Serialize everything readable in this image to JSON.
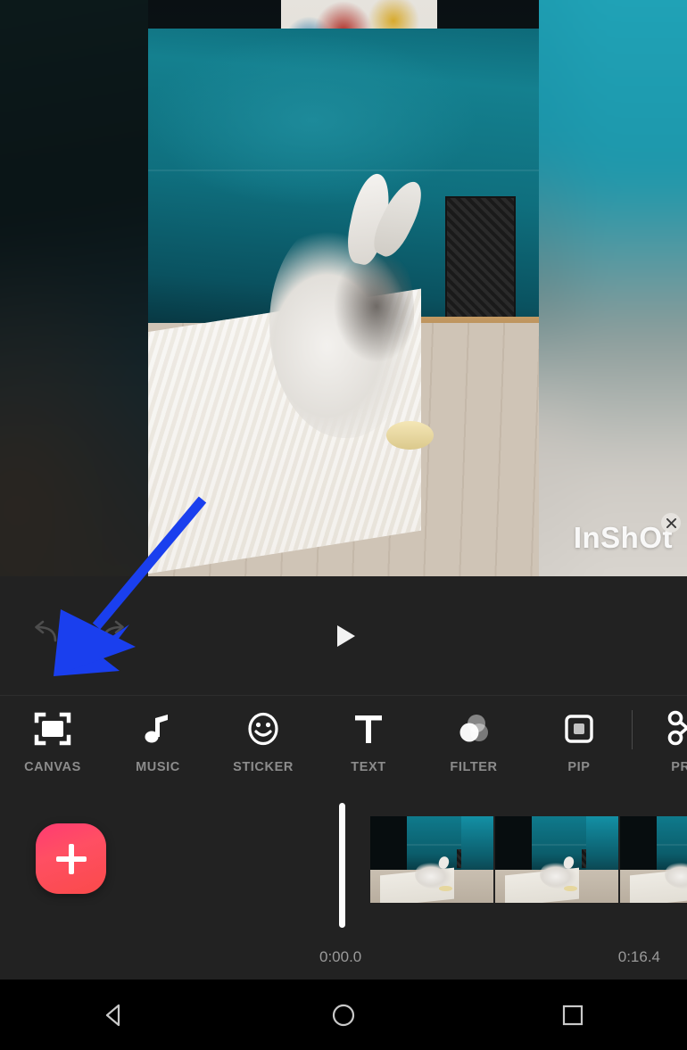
{
  "app": {
    "name": "InShot",
    "watermark": "InShOt"
  },
  "preview": {
    "watermark_close_icon": "close-icon",
    "media_description": "Fluffy white and grey rabbit on a light rug in front of a teal velvet sofa"
  },
  "transport": {
    "undo_icon": "undo-icon",
    "redo_icon": "redo-icon",
    "play_icon": "play-icon"
  },
  "toolbar": {
    "items": [
      {
        "label": "CANVAS",
        "icon": "canvas-icon"
      },
      {
        "label": "MUSIC",
        "icon": "music-note-icon"
      },
      {
        "label": "STICKER",
        "icon": "smiley-icon"
      },
      {
        "label": "TEXT",
        "icon": "text-t-icon"
      },
      {
        "label": "FILTER",
        "icon": "filter-circles-icon"
      },
      {
        "label": "PIP",
        "icon": "picture-in-picture-icon"
      },
      {
        "label": "PRE",
        "icon": "scissors-icon"
      }
    ]
  },
  "timeline": {
    "add_label": "+",
    "add_icon": "plus-icon",
    "playhead_icon": "playhead-handle",
    "start_time": "0:00.0",
    "end_time": "0:16.4",
    "clip_count": 3
  },
  "navbar": {
    "back": "back-triangle-icon",
    "home": "home-circle-icon",
    "recents": "recents-square-icon"
  },
  "annotation": {
    "arrow_color": "#1a3fee",
    "points_to": "CANVAS"
  },
  "colors": {
    "editor_bg": "#222222",
    "label_gray": "#8c8c8c",
    "accent_pink": "#ff3b72",
    "accent_red": "#fa4a4a",
    "annotation_blue": "#1a3fee",
    "nav_bg": "#000000"
  }
}
